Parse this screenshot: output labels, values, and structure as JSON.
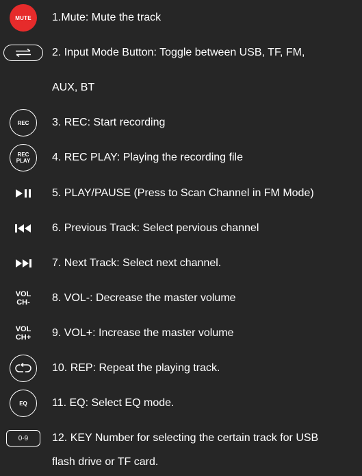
{
  "icons": {
    "mute": {
      "label": "MUTE",
      "color": "#e62b2b",
      "name": "mute-button-icon"
    },
    "input_mode": {
      "name": "toggle-arrows-icon"
    },
    "rec": {
      "label": "REC"
    },
    "rec_play": {
      "line1": "REC",
      "line2": "PLAY"
    },
    "play_pause": {
      "glyph": "▶❙❙",
      "name": "play-pause-icon"
    },
    "previous": {
      "glyph": "❙◀◀",
      "name": "previous-track-icon"
    },
    "next": {
      "glyph": "▶▶❙",
      "name": "next-track-icon"
    },
    "vol_down": {
      "line1": "VOL",
      "line2": "CH-"
    },
    "vol_up": {
      "line1": "VOL",
      "line2": "CH+"
    },
    "repeat": {
      "name": "repeat-icon"
    },
    "eq": {
      "label": "EQ"
    },
    "key": {
      "label": "0-9"
    }
  },
  "items": [
    {
      "text": "1.Mute: Mute the track"
    },
    {
      "text": "2. Input Mode Button: Toggle between USB, TF, FM,",
      "cont": "AUX, BT"
    },
    {
      "text": "3. REC: Start recording"
    },
    {
      "text": "4. REC PLAY: Playing the recording file"
    },
    {
      "text": "5. PLAY/PAUSE (Press to Scan Channel in FM Mode)"
    },
    {
      "text": "6. Previous Track: Select pervious channel"
    },
    {
      "text": "7. Next Track: Select next channel."
    },
    {
      "text": "8. VOL-: Decrease the master volume"
    },
    {
      "text": "9. VOL+: Increase the master volume"
    },
    {
      "text": "10. REP: Repeat the playing track."
    },
    {
      "text": "11. EQ: Select EQ mode."
    },
    {
      "text": "12. KEY Number for selecting the certain track for USB",
      "cont": "flash drive or TF card."
    }
  ]
}
